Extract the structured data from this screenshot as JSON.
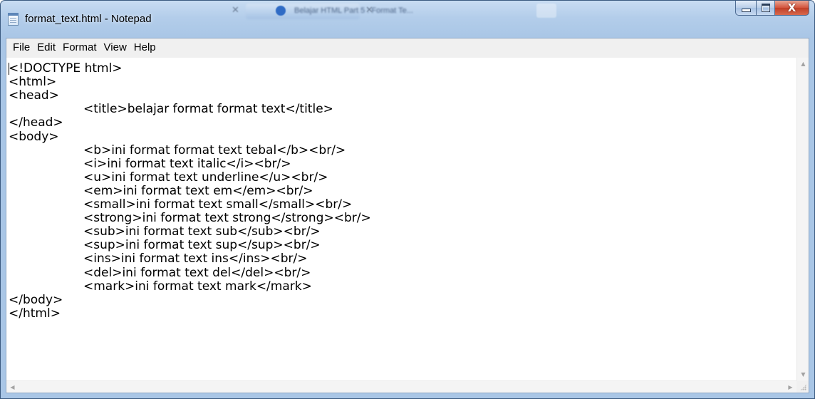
{
  "window": {
    "title": "format_text.html - Notepad",
    "background_tab_title": "Belajar HTML Part 5 : Format Te..."
  },
  "caption": {
    "minimize_icon": "minimize-icon",
    "maximize_icon": "maximize-icon",
    "close_label": "X"
  },
  "menu": {
    "file": "File",
    "edit": "Edit",
    "format": "Format",
    "view": "View",
    "help": "Help"
  },
  "editor": {
    "lines": [
      "<!DOCTYPE html>",
      "<html>",
      "<head>",
      "\t<title>belajar format format text</title>",
      "</head>",
      "<body>",
      "\t<b>ini format format text tebal</b><br/>",
      "\t<i>ini format text italic</i><br/>",
      "\t<u>ini format text underline</u><br/>",
      "\t<em>ini format text em</em><br/>",
      "\t<small>ini format text small</small><br/>",
      "\t<strong>ini format text strong</strong><br/>",
      "\t<sub>ini format text sub</sub><br/>",
      "\t<sup>ini format text sup</sup><br/>",
      "\t<ins>ini format text ins</ins><br/>",
      "\t<del>ini format text del</del><br/>",
      "\t<mark>ini format text mark</mark>",
      "</body>",
      "</html>"
    ]
  },
  "colors": {
    "titlebar": "#b3cdea",
    "close_button": "#c94a33",
    "menubar": "#f0f0f0",
    "editor_background": "#ffffff"
  }
}
